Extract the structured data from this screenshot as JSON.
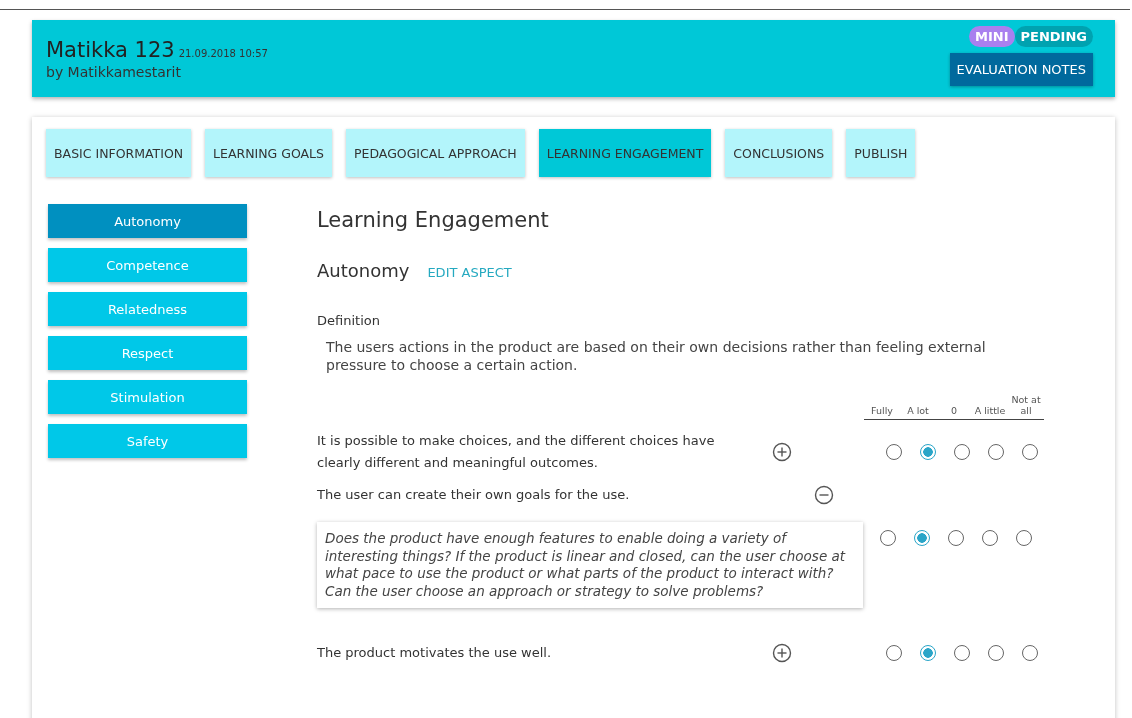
{
  "header": {
    "title": "Matikka 123",
    "timestamp": "21.09.2018 10:57",
    "author": "by Matikkamestarit",
    "badges": [
      {
        "label": "MINI",
        "color": "#a980ef"
      },
      {
        "label": "PENDING",
        "color": "#00a2b0"
      }
    ],
    "notes_button": "EVALUATION NOTES"
  },
  "tabs": [
    {
      "label": "BASIC INFORMATION",
      "selected": false
    },
    {
      "label": "LEARNING GOALS",
      "selected": false
    },
    {
      "label": "PEDAGOGICAL APPROACH",
      "selected": false
    },
    {
      "label": "LEARNING ENGAGEMENT",
      "selected": true
    },
    {
      "label": "CONCLUSIONS",
      "selected": false
    },
    {
      "label": "PUBLISH",
      "selected": false
    }
  ],
  "sidebar": {
    "items": [
      {
        "label": "Autonomy",
        "selected": true
      },
      {
        "label": "Competence",
        "selected": false
      },
      {
        "label": "Relatedness",
        "selected": false
      },
      {
        "label": "Respect",
        "selected": false
      },
      {
        "label": "Stimulation",
        "selected": false
      },
      {
        "label": "Safety",
        "selected": false
      }
    ]
  },
  "main": {
    "heading": "Learning Engagement",
    "aspect": "Autonomy",
    "edit_link": "EDIT ASPECT",
    "definition_label": "Definition",
    "definition": "The users actions in the product are based on their own decisions rather than feeling external pressure to choose a certain action.",
    "scale": [
      "Fully",
      "A lot",
      "0",
      "A little",
      "Not at all"
    ],
    "questions": [
      {
        "text": "It is possible to make choices, and the different choices have clearly different and meaningful outcomes.",
        "expanded": false,
        "options": [
          {
            "selected": false
          },
          {
            "selected": true
          },
          {
            "selected": false
          },
          {
            "selected": false
          },
          {
            "selected": false
          }
        ]
      },
      {
        "text": "The user can create their own goals for the use.",
        "expanded": true,
        "hint": "Does the product have enough features to enable doing a variety of interesting things? If the product is linear and closed, can the user choose at what pace to use the product or what parts of the product to interact with? Can the user choose an approach or strategy to solve problems?",
        "options": [
          {
            "selected": false
          },
          {
            "selected": true
          },
          {
            "selected": false
          },
          {
            "selected": false
          },
          {
            "selected": false
          }
        ]
      },
      {
        "text": "The product motivates the use well.",
        "expanded": false,
        "options": [
          {
            "selected": false
          },
          {
            "selected": true
          },
          {
            "selected": false
          },
          {
            "selected": false
          },
          {
            "selected": false
          }
        ]
      }
    ]
  }
}
